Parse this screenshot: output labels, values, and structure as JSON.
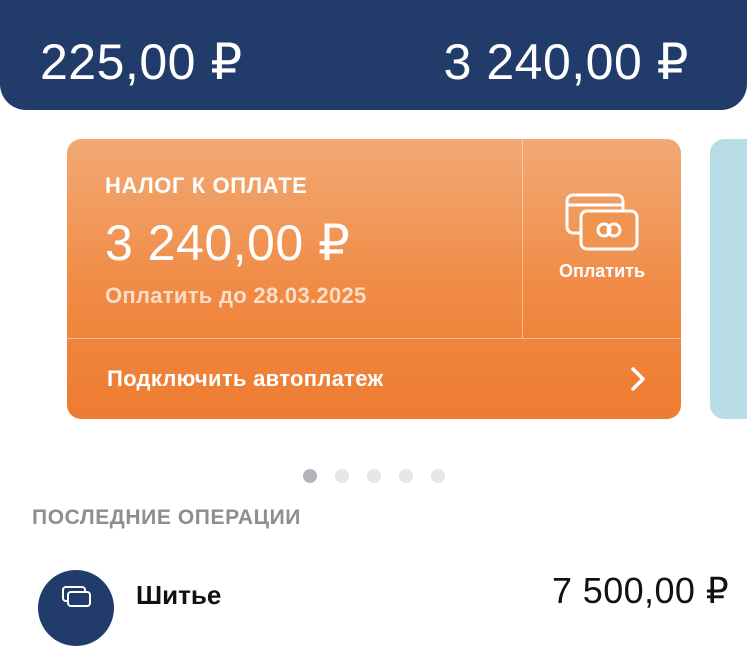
{
  "header": {
    "amount_left": "225,00 ₽",
    "amount_right": "3 240,00 ₽"
  },
  "tax_card": {
    "label": "НАЛОГ К ОПЛАТЕ",
    "amount": "3 240,00 ₽",
    "due_text": "Оплатить до 28.03.2025",
    "pay_label": "Оплатить",
    "pay_icon": "cards-icon",
    "autopay_label": "Подключить автоплатеж",
    "autopay_icon": "chevron-right-icon"
  },
  "pager": {
    "count": 5,
    "active_index": 0
  },
  "operations": {
    "title": "ПОСЛЕДНИЕ ОПЕРАЦИИ",
    "items": [
      {
        "name": "Шитье",
        "amount": "7 500,00 ₽",
        "icon": "receipt-icon"
      }
    ]
  },
  "colors": {
    "header_bg": "#213c6a",
    "card_orange": "#f08a43",
    "next_card": "#b9dde6",
    "muted_text": "#8d8d93"
  }
}
